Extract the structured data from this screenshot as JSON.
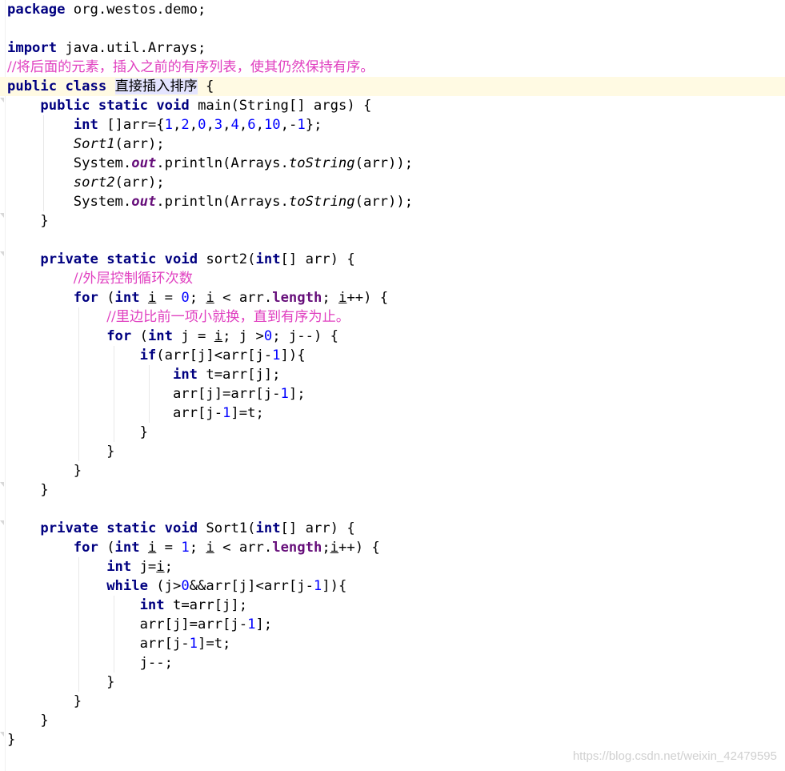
{
  "editor": {
    "language": "java",
    "current_line": 4,
    "colors": {
      "keyword": "#000080",
      "number": "#0000ff",
      "comment": "#e040c0",
      "field": "#660e7a",
      "current_line_bg": "#fffae3",
      "identifier_highlight": "#e4e4ff"
    },
    "lines": [
      "package org.westos.demo;",
      "",
      "import java.util.Arrays;",
      "//将后面的元素，插入之前的有序列表，使其仍然保持有序。",
      "public class 直接插入排序 {",
      "    public static void main(String[] args) {",
      "        int []arr={1,2,0,3,4,6,10,-1};",
      "        Sort1(arr);",
      "        System.out.println(Arrays.toString(arr));",
      "        sort2(arr);",
      "        System.out.println(Arrays.toString(arr));",
      "    }",
      "",
      "    private static void sort2(int[] arr) {",
      "        //外层控制循环次数",
      "        for (int i = 0; i < arr.length; i++) {",
      "            //里边比前一项小就换，直到有序为止。",
      "            for (int j = i; j >0; j--) {",
      "                if(arr[j]<arr[j-1]){",
      "                    int t=arr[j];",
      "                    arr[j]=arr[j-1];",
      "                    arr[j-1]=t;",
      "                }",
      "            }",
      "        }",
      "    }",
      "",
      "    private static void Sort1(int[] arr) {",
      "        for (int i = 1; i < arr.length;i++) {",
      "            int j=i;",
      "            while (j>0&&arr[j]<arr[j-1]){",
      "                int t=arr[j];",
      "                arr[j]=arr[j-1];",
      "                arr[j-1]=t;",
      "                j--;",
      "            }",
      "        }",
      "    }",
      "}"
    ]
  },
  "tokens": {
    "l1": [
      "package",
      " org.westos.demo;"
    ],
    "l3": [
      "import",
      " java.util.Arrays;"
    ],
    "l4": "//将后面的元素，插入之前的有序列表，使其仍然保持有序。",
    "l5": [
      "public",
      " ",
      "class",
      " ",
      "直接插入排序",
      " {"
    ],
    "l6": [
      "    ",
      "public",
      " ",
      "static",
      " ",
      "void",
      " main(String[] args) {"
    ],
    "l7": [
      "        ",
      "int",
      " []arr={",
      "1",
      ",",
      "2",
      ",",
      "0",
      ",",
      "3",
      ",",
      "4",
      ",",
      "6",
      ",",
      "10",
      ",-",
      "1",
      "};"
    ],
    "l8": [
      "        ",
      "Sort1",
      "(arr);"
    ],
    "l9": [
      "        System.",
      "out",
      ".println(Arrays.",
      "toString",
      "(arr));"
    ],
    "l10": [
      "        ",
      "sort2",
      "(arr);"
    ],
    "l11": [
      "        System.",
      "out",
      ".println(Arrays.",
      "toString",
      "(arr));"
    ],
    "l12": "    }",
    "l14": [
      "    ",
      "private",
      " ",
      "static",
      " ",
      "void",
      " sort2(",
      "int",
      "[] arr) {"
    ],
    "l15": [
      "        ",
      "//外层控制循环次数"
    ],
    "l16": [
      "        ",
      "for",
      " (",
      "int",
      " ",
      "i",
      " = ",
      "0",
      "; ",
      "i",
      " < arr.",
      "length",
      "; ",
      "i",
      "++) {"
    ],
    "l17": [
      "            ",
      "//里边比前一项小就换，直到有序为止。"
    ],
    "l18": [
      "            ",
      "for",
      " (",
      "int",
      " j = ",
      "i",
      "; j >",
      "0",
      "; j--) {"
    ],
    "l19": [
      "                ",
      "if",
      "(arr[j]<arr[j-",
      "1",
      "]){"
    ],
    "l20": [
      "                    ",
      "int",
      " t=arr[j];"
    ],
    "l21": [
      "                    arr[j]=arr[j-",
      "1",
      "];"
    ],
    "l22": [
      "                    arr[j-",
      "1",
      "]=t;"
    ],
    "l23": "                }",
    "l24": "            }",
    "l25": "        }",
    "l26": "    }",
    "l28": [
      "    ",
      "private",
      " ",
      "static",
      " ",
      "void",
      " Sort1(",
      "int",
      "[] arr) {"
    ],
    "l29": [
      "        ",
      "for",
      " (",
      "int",
      " ",
      "i",
      " = ",
      "1",
      "; ",
      "i",
      " < arr.",
      "length",
      ";",
      "i",
      "++) {"
    ],
    "l30": [
      "            ",
      "int",
      " j=",
      "i",
      ";"
    ],
    "l31": [
      "            ",
      "while",
      " (j>",
      "0",
      "&&arr[j]<arr[j-",
      "1",
      "]){"
    ],
    "l32": [
      "                ",
      "int",
      " t=arr[j];"
    ],
    "l33": [
      "                arr[j]=arr[j-",
      "1",
      "];"
    ],
    "l34": [
      "                arr[j-",
      "1",
      "]=t;"
    ],
    "l35": "                j--;",
    "l36": "            }",
    "l37": "        }",
    "l38": "    }",
    "l39": "}"
  },
  "watermark": "https://blog.csdn.net/weixin_42479595"
}
